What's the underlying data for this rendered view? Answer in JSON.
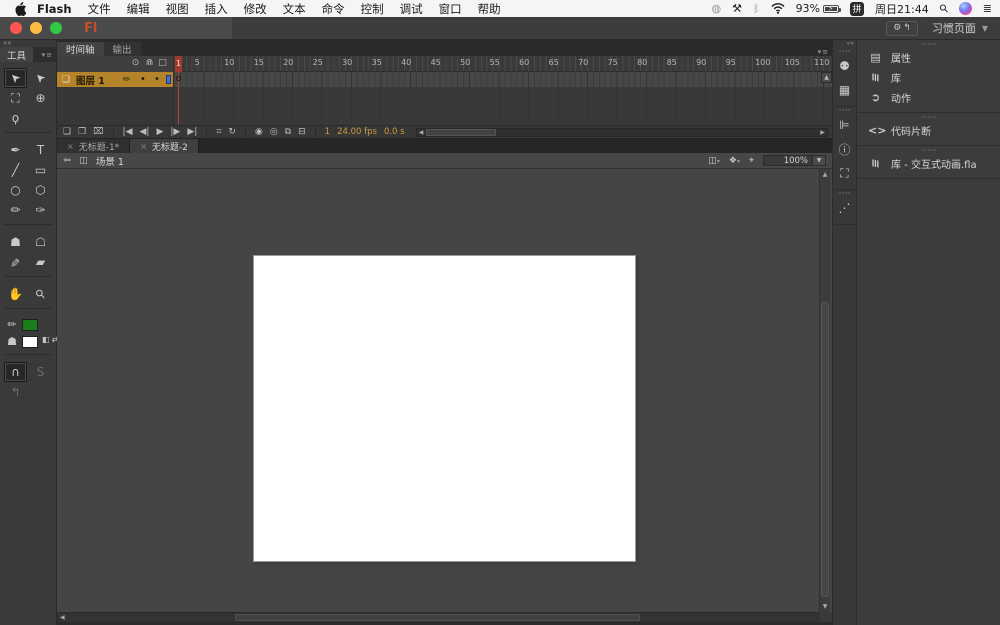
{
  "menubar": {
    "app_name": "Flash",
    "items": [
      "文件",
      "编辑",
      "视图",
      "插入",
      "修改",
      "文本",
      "命令",
      "控制",
      "调试",
      "窗口",
      "帮助"
    ],
    "status": {
      "battery_percent": "93%",
      "ime_label": "拼",
      "clock": "周日21:44"
    }
  },
  "titlebar": {
    "logo": "Fl",
    "workspace_label": "习惯页面"
  },
  "tools": {
    "title": "工具",
    "stroke_color": "#1b7e1b",
    "fill_color": "#ffffff",
    "items": [
      {
        "type": "tool",
        "name": "selection-tool",
        "glyph": "➤",
        "cls": "rotUL",
        "selected": true
      },
      {
        "type": "tool",
        "name": "subselection-tool",
        "glyph": "➤",
        "cls": "rotUL"
      },
      {
        "type": "tool",
        "name": "free-transform-tool",
        "glyph": "⛶"
      },
      {
        "type": "tool",
        "name": "3d-rotation-tool",
        "glyph": "⊕"
      },
      {
        "type": "tool",
        "name": "lasso-tool",
        "glyph": "ϙ"
      },
      {
        "type": "spacer"
      },
      {
        "type": "divider"
      },
      {
        "type": "tool",
        "name": "pen-tool",
        "glyph": "✒"
      },
      {
        "type": "tool",
        "name": "text-tool",
        "glyph": "T"
      },
      {
        "type": "tool",
        "name": "line-tool",
        "glyph": "╱"
      },
      {
        "type": "tool",
        "name": "rectangle-tool",
        "glyph": "▭"
      },
      {
        "type": "tool",
        "name": "oval-tool",
        "glyph": "○"
      },
      {
        "type": "tool",
        "name": "polystar-tool",
        "glyph": "⬡"
      },
      {
        "type": "tool",
        "name": "pencil-tool",
        "glyph": "✏"
      },
      {
        "type": "tool",
        "name": "brush-tool",
        "glyph": "✑"
      },
      {
        "type": "divider"
      },
      {
        "type": "tool",
        "name": "paint-bucket-tool",
        "glyph": "☗"
      },
      {
        "type": "tool",
        "name": "ink-bottle-tool",
        "glyph": "☖"
      },
      {
        "type": "tool",
        "name": "eyedropper-tool",
        "glyph": "✐",
        "cls": "rot180"
      },
      {
        "type": "tool",
        "name": "eraser-tool",
        "glyph": "▰"
      },
      {
        "type": "divider"
      },
      {
        "type": "tool",
        "name": "hand-tool",
        "glyph": "✋"
      },
      {
        "type": "tool",
        "name": "zoom-tool",
        "glyph": "⚲",
        "cls": "rot45"
      },
      {
        "type": "divider"
      },
      {
        "type": "stroke"
      },
      {
        "type": "fill"
      },
      {
        "type": "divider"
      },
      {
        "type": "tool",
        "name": "snap-to-objects-toggle",
        "glyph": "∩",
        "selected": true
      },
      {
        "type": "tool",
        "name": "smooth-option",
        "glyph": "S",
        "disabled": true
      },
      {
        "type": "tool",
        "name": "straighten-option",
        "glyph": "↰",
        "disabled": true
      },
      {
        "type": "spacer"
      }
    ]
  },
  "timeline": {
    "tabs": [
      {
        "label": "时间轴",
        "active": true
      },
      {
        "label": "输出",
        "active": false
      }
    ],
    "layer": {
      "name": "图层 1"
    },
    "ruler_numbers": [
      1,
      5,
      10,
      15,
      20,
      25,
      30,
      35,
      40,
      45,
      50,
      55,
      60,
      65,
      70,
      75,
      80,
      85,
      90,
      95,
      100,
      105,
      110
    ],
    "controls": {
      "current_frame": "1",
      "frame_rate": "24.00 fps",
      "elapsed_time": "0.0 s"
    }
  },
  "documents": {
    "tabs": [
      {
        "label": "无标题-1*",
        "active": false
      },
      {
        "label": "无标题-2",
        "active": true
      }
    ]
  },
  "edit_bar": {
    "scene_label": "场景 1",
    "zoom_value": "100%"
  },
  "dock": {
    "groups": [
      [
        {
          "name": "color-panel-icon",
          "glyph": "⚉"
        },
        {
          "name": "swatches-panel-icon",
          "glyph": "▦"
        }
      ],
      [
        {
          "name": "align-panel-icon",
          "glyph": "⊫"
        },
        {
          "name": "info-panel-icon",
          "glyph": "ⓘ"
        },
        {
          "name": "transform-panel-icon",
          "glyph": "⛶"
        }
      ],
      [
        {
          "name": "motion-presets-panel-icon",
          "glyph": "⋰"
        }
      ]
    ]
  },
  "right_panel": {
    "groups": [
      [
        {
          "icon_name": "properties-icon",
          "glyph": "▤",
          "label": "属性"
        },
        {
          "icon_name": "library-icon",
          "glyph": "≡",
          "cls": "rot90",
          "label": "库"
        },
        {
          "icon_name": "actions-icon",
          "glyph": "➲",
          "label": "动作"
        }
      ],
      [
        {
          "icon_name": "code-snippets-icon",
          "glyph": "<>",
          "label": "代码片断"
        }
      ],
      [
        {
          "icon_name": "library-icon",
          "glyph": "≡",
          "cls": "rot90",
          "label": "库 - 交互式动画.fla"
        }
      ]
    ]
  },
  "colors": {
    "layer_selected": "#b5832a",
    "playhead_red": "#a03a2e",
    "frame_info_orange": "#cf9a3d",
    "traffic_red": "#fc5753",
    "traffic_yellow": "#fdbc40",
    "traffic_green": "#33c748"
  }
}
